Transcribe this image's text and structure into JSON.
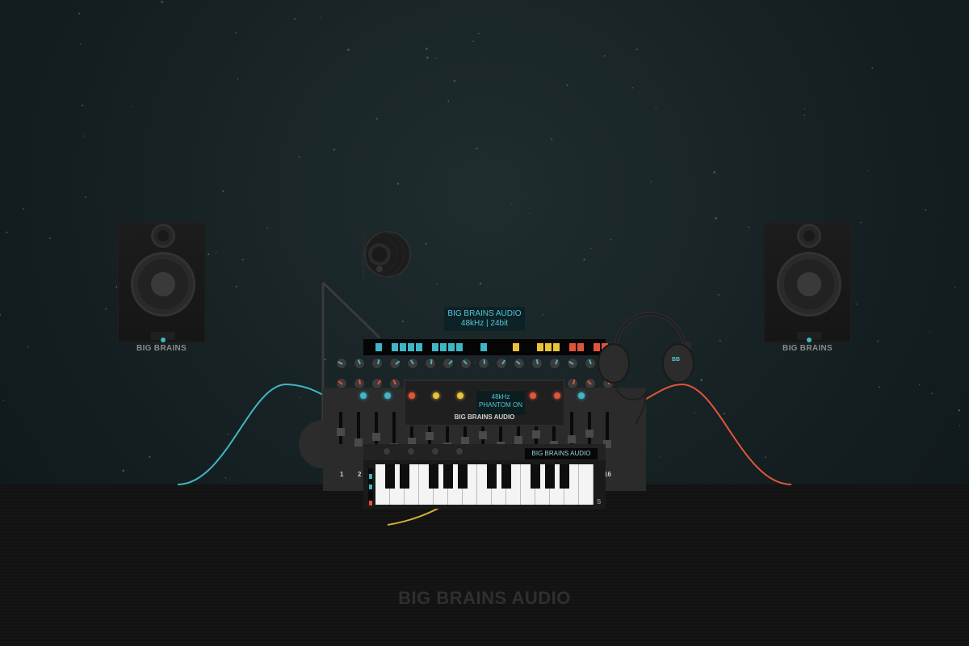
{
  "scene": {
    "left_speaker_brand": "BIG BRAINS",
    "right_speaker_brand": "BIG BRAINS",
    "top_display": {
      "line1": "BIG BRAINS AUDIO",
      "line2": "48kHz | 24bit"
    },
    "center_display": {
      "line1": "48kHz",
      "line2": "PHANTOM ON"
    },
    "console_brand": "BIG BRAINS AUDIO",
    "keyboard_label": "BIG BRAINS AUDIO",
    "keyboard_brand_partial": "S",
    "headphone_label": "BB",
    "channel_numbers": [
      "1",
      "2",
      "16"
    ],
    "footer_brand": "BIG BRAINS AUDIO"
  },
  "colors": {
    "accent_cyan": "#3fb6c8",
    "accent_red": "#e0553a",
    "accent_yellow": "#e8c23a",
    "cable_yellow": "#d4b035"
  },
  "icons": {
    "microphone": "studio-microphone-icon",
    "headphones": "headphones-icon"
  }
}
